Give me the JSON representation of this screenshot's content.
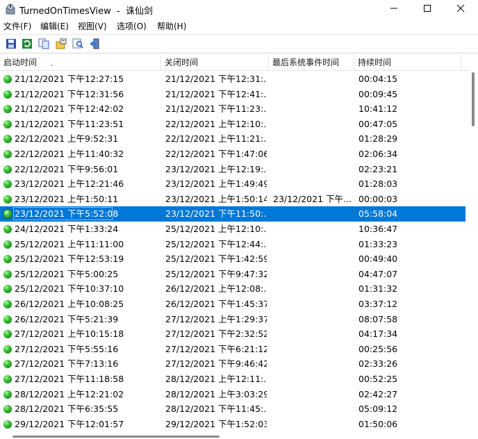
{
  "window": {
    "title": "TurnedOnTimesView  -  诛仙剑",
    "minimize_icon": "minimize-icon",
    "maximize_icon": "maximize-icon",
    "close_icon": "close-icon"
  },
  "menu": {
    "items": [
      {
        "label": "文件(F)"
      },
      {
        "label": "编辑(E)"
      },
      {
        "label": "视图(V)"
      },
      {
        "label": "选项(O)"
      },
      {
        "label": "帮助(H)"
      }
    ]
  },
  "toolbar": {
    "buttons": [
      {
        "icon": "save-icon"
      },
      {
        "icon": "refresh-icon"
      },
      {
        "icon": "copy-icon"
      },
      {
        "icon": "properties-icon"
      },
      {
        "icon": "find-icon"
      },
      {
        "icon": "exit-icon"
      }
    ]
  },
  "table": {
    "columns": [
      "启动时间",
      "关闭时间",
      "最后系统事件时间",
      "持续时间"
    ],
    "sort_indicator": "ascending",
    "selected_row": 9,
    "rows": [
      [
        "21/12/2021 下午12:27:15",
        "21/12/2021 下午12:31:...",
        "",
        "00:04:15"
      ],
      [
        "21/12/2021 下午12:31:56",
        "21/12/2021 下午12:41:...",
        "",
        "00:09:45"
      ],
      [
        "21/12/2021 下午12:42:02",
        "21/12/2021 下午11:23:...",
        "",
        "10:41:12"
      ],
      [
        "21/12/2021 下午11:23:51",
        "22/12/2021 上午12:10:...",
        "",
        "00:47:05"
      ],
      [
        "22/12/2021 上午9:52:31",
        "22/12/2021 上午11:21:...",
        "",
        "01:28:29"
      ],
      [
        "22/12/2021 上午11:40:32",
        "22/12/2021 下午1:47:06",
        "",
        "02:06:34"
      ],
      [
        "22/12/2021 下午9:56:01",
        "23/12/2021 上午12:19:...",
        "",
        "02:23:21"
      ],
      [
        "23/12/2021 上午12:21:46",
        "23/12/2021 上午1:49:49",
        "",
        "01:28:03"
      ],
      [
        "23/12/2021 上午1:50:11",
        "23/12/2021 上午1:50:14",
        "23/12/2021 下午...",
        "00:00:03"
      ],
      [
        "23/12/2021 下午5:52:08",
        "23/12/2021 下午11:50:...",
        "",
        "05:58:04"
      ],
      [
        "24/12/2021 下午1:33:24",
        "25/12/2021 上午12:10:...",
        "",
        "10:36:47"
      ],
      [
        "25/12/2021 上午11:11:00",
        "25/12/2021 下午12:44:...",
        "",
        "01:33:23"
      ],
      [
        "25/12/2021 下午12:53:19",
        "25/12/2021 下午1:42:59",
        "",
        "00:49:40"
      ],
      [
        "25/12/2021 下午5:00:25",
        "25/12/2021 下午9:47:32",
        "",
        "04:47:07"
      ],
      [
        "25/12/2021 下午10:37:10",
        "26/12/2021 上午12:08:...",
        "",
        "01:31:32"
      ],
      [
        "26/12/2021 上午10:08:25",
        "26/12/2021 下午1:45:37",
        "",
        "03:37:12"
      ],
      [
        "26/12/2021 下午5:21:39",
        "27/12/2021 上午1:29:37",
        "",
        "08:07:58"
      ],
      [
        "27/12/2021 上午10:15:18",
        "27/12/2021 下午2:32:52",
        "",
        "04:17:34"
      ],
      [
        "27/12/2021 下午5:55:16",
        "27/12/2021 下午6:21:12",
        "",
        "00:25:56"
      ],
      [
        "27/12/2021 下午7:13:16",
        "27/12/2021 下午9:46:42",
        "",
        "02:33:26"
      ],
      [
        "27/12/2021 下午11:18:58",
        "28/12/2021 上午12:11:...",
        "",
        "00:52:25"
      ],
      [
        "28/12/2021 上午12:21:02",
        "28/12/2021 上午3:03:29",
        "",
        "02:42:27"
      ],
      [
        "28/12/2021 下午6:35:55",
        "28/12/2021 下午11:45:...",
        "",
        "05:09:12"
      ],
      [
        "29/12/2021 下午12:01:57",
        "29/12/2021 下午1:52:03",
        "",
        "01:50:06"
      ]
    ]
  },
  "colors": {
    "selection": "#0078d7",
    "status_ball": "#3cc43a"
  }
}
